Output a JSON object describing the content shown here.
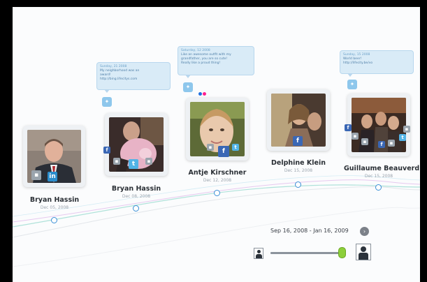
{
  "timeline": {
    "people": [
      {
        "name": "Bryan Hassin",
        "date": "Dec 05, 2008",
        "badges": [
          "grey",
          "in"
        ]
      },
      {
        "name": "Bryan Hassin",
        "date": "Dec 08, 2008",
        "badges": [
          "fb",
          "grey",
          "tw",
          "grey"
        ]
      },
      {
        "name": "Antje Kirschner",
        "date": "Dec 12, 2008",
        "badges": [
          "grey",
          "fb",
          "tw"
        ]
      },
      {
        "name": "Delphine Klein",
        "date": "Dec 15, 2008",
        "badges": [
          "fb"
        ]
      },
      {
        "name": "Guillaume Beauverd",
        "date": "Dec 15, 2008",
        "badges": [
          "fb",
          "grey",
          "grey",
          "fb",
          "grey",
          "tw",
          "grey"
        ]
      }
    ],
    "posts": [
      {
        "date": "Sunday, 21 2008",
        "lines": [
          "My neighborhood was an",
          "award!",
          "http://bing.lifecitys.com"
        ]
      },
      {
        "date": "Saturday, 12 2008",
        "lines": [
          "Like an awesome outfit with my",
          "grandfather, you are so cute!",
          "Really like a proud thing!"
        ]
      },
      {
        "date": "Sunday, 15 2008",
        "lines": [
          "World beer!",
          "http://lifecity.be/vo"
        ]
      }
    ]
  },
  "controls": {
    "date_range": "Sep 16, 2008 - Jan 16, 2009",
    "next_glyph": "›",
    "slider_position": 0.93
  },
  "icons": {
    "twitter": "twitter-icon",
    "facebook": "facebook-icon",
    "linkedin": "linkedin-icon",
    "flickr": "flickr-icon",
    "person": "person-icon"
  },
  "colors": {
    "facebook": "#3a67b5",
    "linkedin": "#2c8dcc",
    "twitter": "#52b3e6",
    "node": "#3a8fd6",
    "slider_thumb": "#8ccf3a"
  }
}
